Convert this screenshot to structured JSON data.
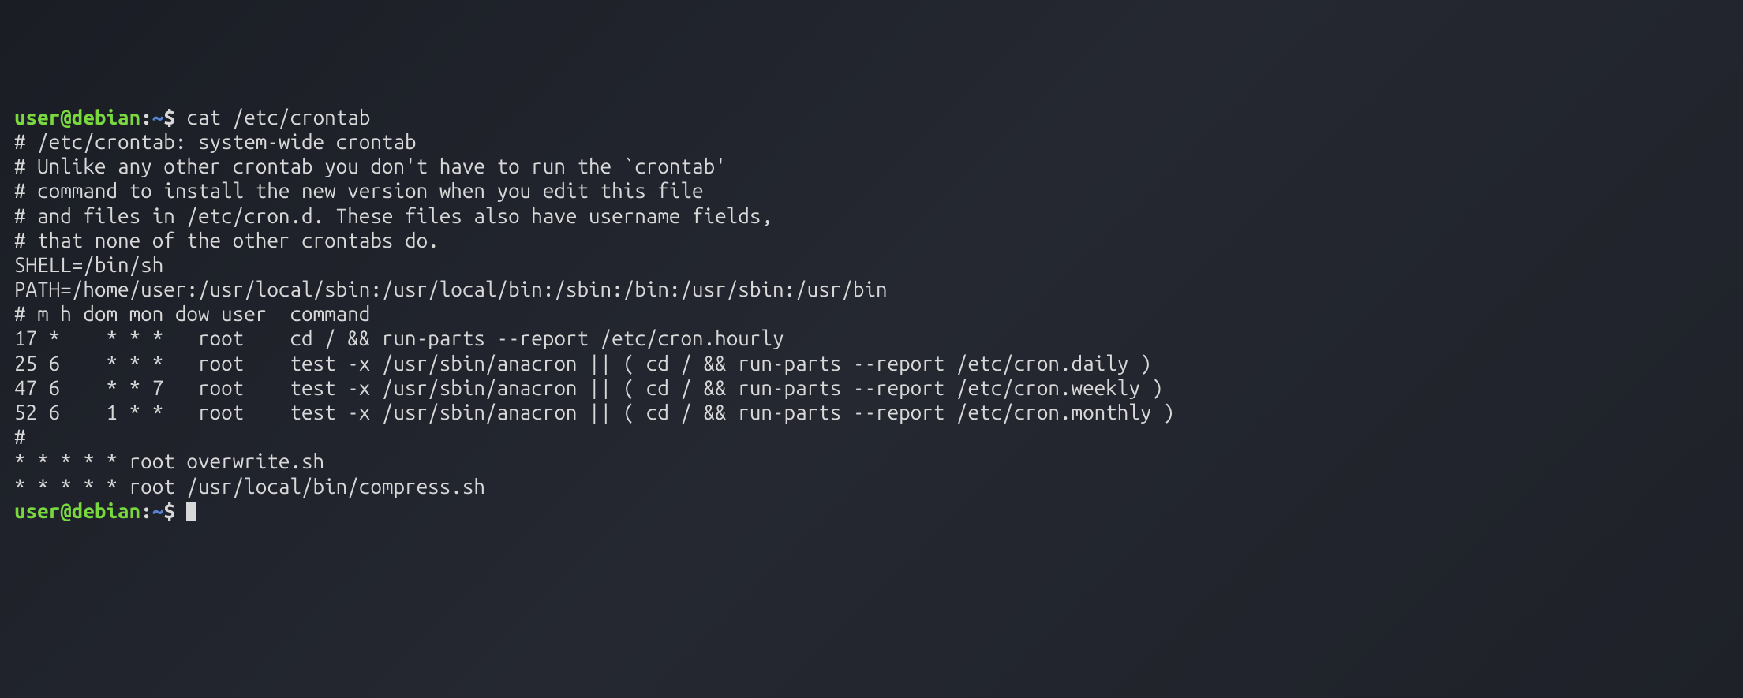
{
  "prompt1": {
    "user": "user",
    "at": "@",
    "host": "debian",
    "colon": ":",
    "path": "~",
    "dollar": "$ ",
    "command": "cat /etc/crontab"
  },
  "output_lines": [
    "# /etc/crontab: system-wide crontab",
    "# Unlike any other crontab you don't have to run the `crontab'",
    "# command to install the new version when you edit this file",
    "# and files in /etc/cron.d. These files also have username fields,",
    "# that none of the other crontabs do.",
    "",
    "SHELL=/bin/sh",
    "PATH=/home/user:/usr/local/sbin:/usr/local/bin:/sbin:/bin:/usr/sbin:/usr/bin",
    "",
    "# m h dom mon dow user  command",
    "17 *    * * *   root    cd / && run-parts --report /etc/cron.hourly",
    "25 6    * * *   root    test -x /usr/sbin/anacron || ( cd / && run-parts --report /etc/cron.daily )",
    "47 6    * * 7   root    test -x /usr/sbin/anacron || ( cd / && run-parts --report /etc/cron.weekly )",
    "52 6    1 * *   root    test -x /usr/sbin/anacron || ( cd / && run-parts --report /etc/cron.monthly )",
    "#",
    "* * * * * root overwrite.sh",
    "* * * * * root /usr/local/bin/compress.sh",
    ""
  ],
  "prompt2": {
    "user": "user",
    "at": "@",
    "host": "debian",
    "colon": ":",
    "path": "~",
    "dollar": "$ "
  }
}
